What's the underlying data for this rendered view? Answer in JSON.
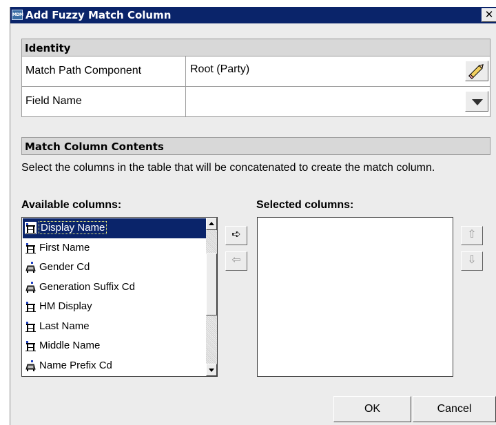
{
  "dialog": {
    "title": "Add Fuzzy Match Column",
    "app_icon_text": "MDM",
    "close_glyph": "✕"
  },
  "identity": {
    "header": "Identity",
    "rows": [
      {
        "label": "Match Path Component",
        "value": "Root (Party)",
        "control": "pencil-icon"
      },
      {
        "label": "Field Name",
        "value": "",
        "control": "chevron-down-icon"
      }
    ]
  },
  "contents": {
    "header": "Match Column Contents",
    "instructions": "Select the columns in the table that will be concatenated to create the match column."
  },
  "available": {
    "label": "Available columns:",
    "items": [
      {
        "name": "Display Name",
        "icon": "text-column-icon",
        "selected": true
      },
      {
        "name": "First Name",
        "icon": "text-column-icon",
        "selected": false
      },
      {
        "name": "Gender Cd",
        "icon": "lookup-column-icon",
        "selected": false
      },
      {
        "name": "Generation Suffix Cd",
        "icon": "lookup-column-icon",
        "selected": false
      },
      {
        "name": "HM Display",
        "icon": "text-column-icon",
        "selected": false
      },
      {
        "name": "Last Name",
        "icon": "text-column-icon",
        "selected": false
      },
      {
        "name": "Middle Name",
        "icon": "text-column-icon",
        "selected": false
      },
      {
        "name": "Name Prefix Cd",
        "icon": "lookup-column-icon",
        "selected": false
      }
    ]
  },
  "selected": {
    "label": "Selected columns:",
    "items": []
  },
  "move_buttons": {
    "add_glyph": "➪",
    "remove_glyph": "⇦",
    "up_glyph": "⇧",
    "down_glyph": "⇩"
  },
  "footer": {
    "ok_label": "OK",
    "cancel_label": "Cancel"
  },
  "colors": {
    "titlebar": "#0a246a",
    "selection": "#0a246a",
    "dialog_bg": "#ececec"
  }
}
